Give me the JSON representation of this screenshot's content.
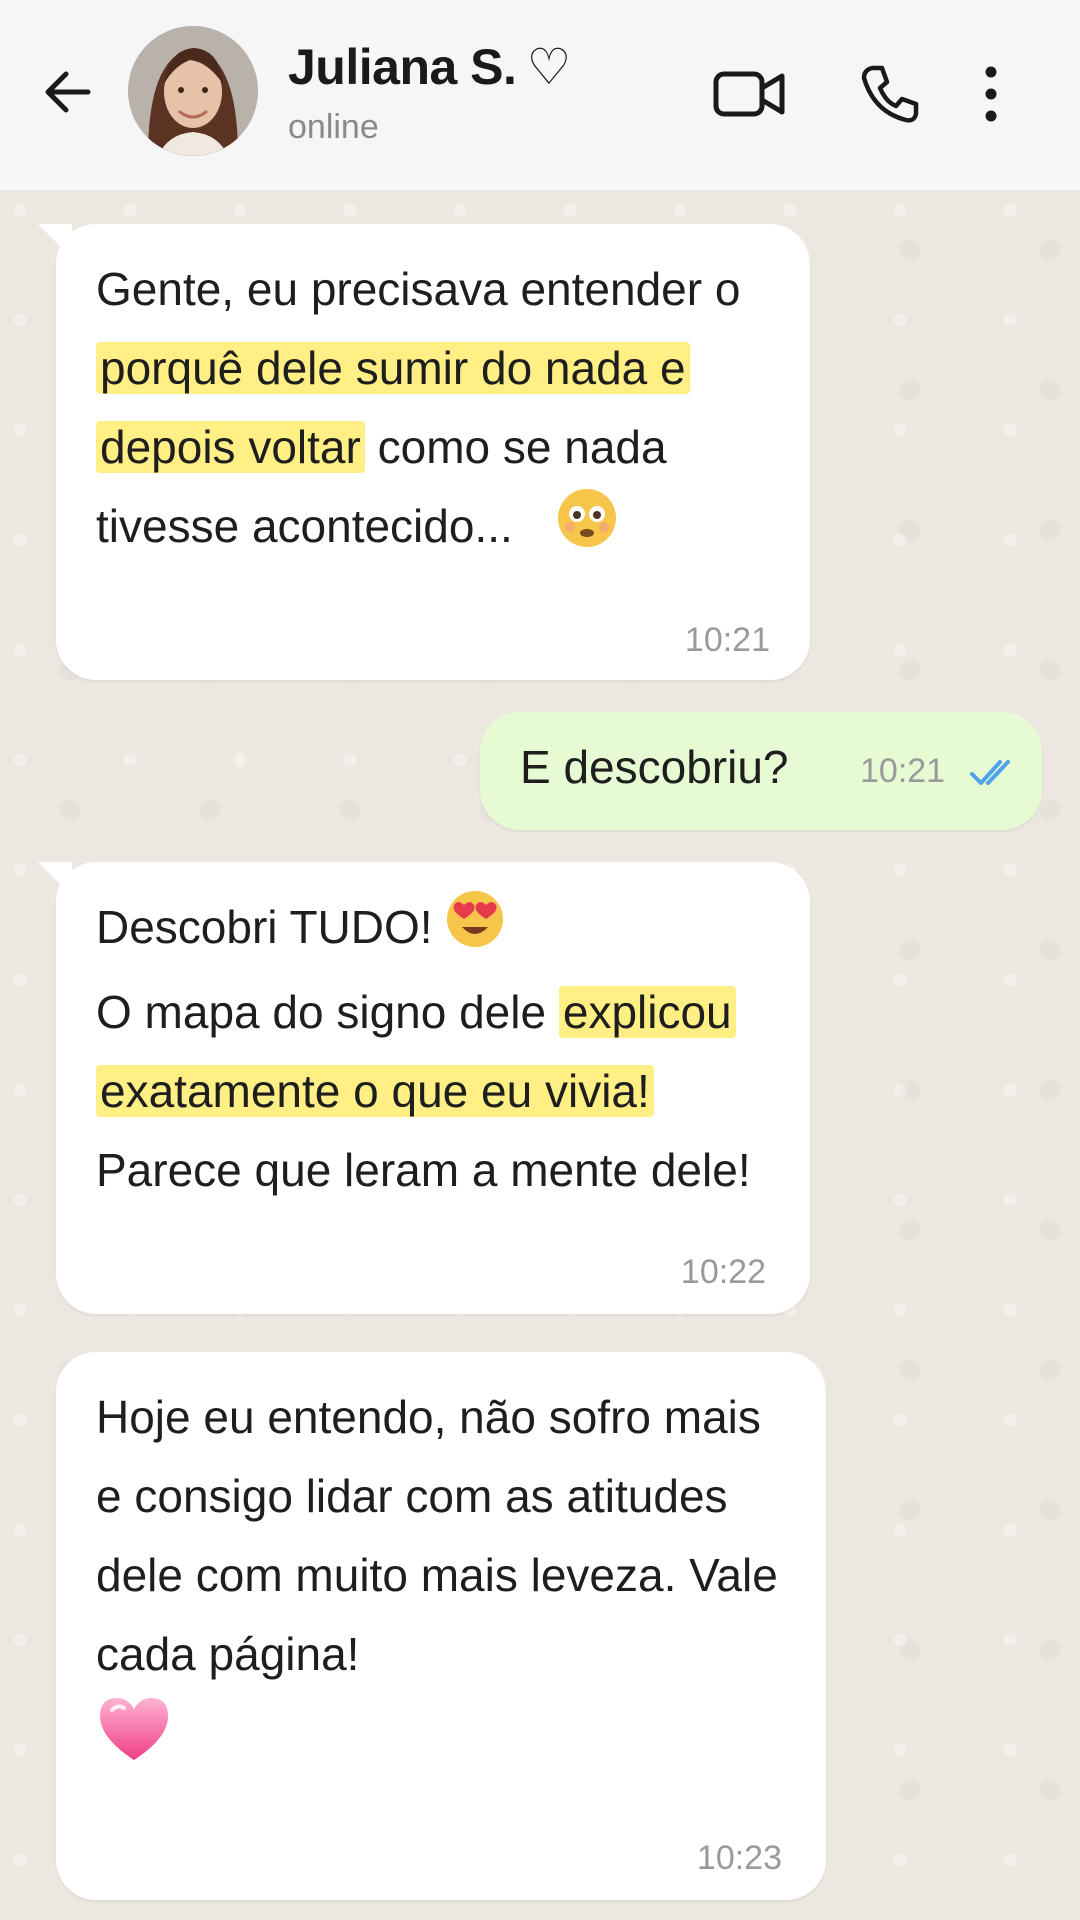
{
  "header": {
    "name": "Juliana S.",
    "name_heart": "♡",
    "status": "online",
    "icons": [
      "back-arrow-icon",
      "video-call-icon",
      "phone-icon",
      "more-vertical-icon"
    ]
  },
  "messages": [
    {
      "direction": "incoming",
      "parts": [
        {
          "text": "Gente, eu precisava entender o ",
          "highlight": false
        },
        {
          "text": "porquê dele sumir do nada e depois voltar",
          "highlight": true
        },
        {
          "text": " como se nada tivesse acontecido...",
          "highlight": false
        }
      ],
      "emoji": "flushed-face-emoji",
      "time": "10:21"
    },
    {
      "direction": "outgoing",
      "text": "E descobriu?",
      "time": "10:21",
      "status": "read-double-check"
    },
    {
      "direction": "incoming",
      "line1": "Descobri TUDO!",
      "emoji1": "heart-eyes-emoji",
      "parts": [
        {
          "text": "O mapa do signo dele ",
          "highlight": false
        },
        {
          "text": "explicou exatamente o que eu vivia!",
          "highlight": true
        },
        {
          "text": " Parece que leram a mente dele!",
          "highlight": false
        }
      ],
      "time": "10:22"
    },
    {
      "direction": "incoming",
      "text": "Hoje eu entendo, não sofro mais e consigo lidar com as atitudes dele com muito mais leveza. Vale cada página!",
      "emoji": "pink-heart-emoji",
      "time": "10:23"
    }
  ],
  "colors": {
    "header_bg": "#f6f6f6",
    "chat_bg": "#ece7e0",
    "incoming_bubble": "#ffffff",
    "outgoing_bubble": "#e6fbd4",
    "highlight": "#ffef84",
    "read_ticks": "#4fa3e8"
  }
}
